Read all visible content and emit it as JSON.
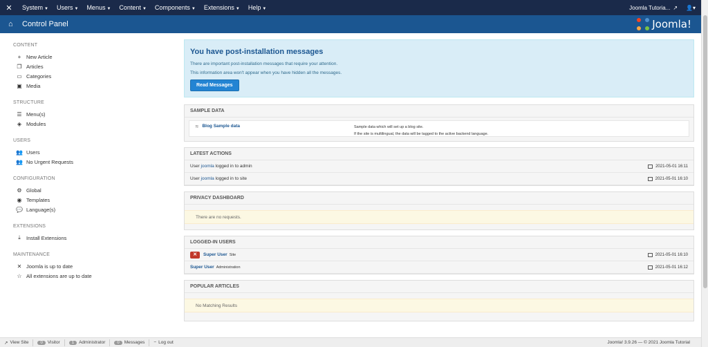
{
  "topnav": {
    "menu": [
      {
        "label": "System"
      },
      {
        "label": "Users"
      },
      {
        "label": "Menus"
      },
      {
        "label": "Content"
      },
      {
        "label": "Components"
      },
      {
        "label": "Extensions"
      },
      {
        "label": "Help"
      }
    ],
    "site_name": "Joomla Tutoria..."
  },
  "header": {
    "title": "Control Panel",
    "brand": "Joomla!"
  },
  "sidebar": {
    "content_heading": "CONTENT",
    "content_items": [
      {
        "label": "New Article",
        "icon": "plus-icon"
      },
      {
        "label": "Articles",
        "icon": "copy-icon"
      },
      {
        "label": "Categories",
        "icon": "folder-icon"
      },
      {
        "label": "Media",
        "icon": "image-icon"
      }
    ],
    "structure_heading": "STRUCTURE",
    "structure_items": [
      {
        "label": "Menu(s)",
        "icon": "list-icon"
      },
      {
        "label": "Modules",
        "icon": "cube-icon"
      }
    ],
    "users_heading": "USERS",
    "users_items": [
      {
        "label": "Users",
        "icon": "users-icon"
      },
      {
        "label": "No Urgent Requests",
        "icon": "users-icon"
      }
    ],
    "configuration_heading": "CONFIGURATION",
    "configuration_items": [
      {
        "label": "Global",
        "icon": "gear-icon"
      },
      {
        "label": "Templates",
        "icon": "eye-icon"
      },
      {
        "label": "Language(s)",
        "icon": "comments-icon"
      }
    ],
    "extensions_heading": "EXTENSIONS",
    "extensions_items": [
      {
        "label": "Install Extensions",
        "icon": "download-icon"
      }
    ],
    "maintenance_heading": "MAINTENANCE",
    "maintenance_items": [
      {
        "label": "Joomla is up to date",
        "icon": "joomla-icon"
      },
      {
        "label": "All extensions are up to date",
        "icon": "star-icon"
      }
    ]
  },
  "alert": {
    "title": "You have post-installation messages",
    "line1": "There are important post-installation messages that require your attention.",
    "line2": "This information area won't appear when you have hidden all the messages.",
    "button": "Read Messages"
  },
  "sample_data": {
    "heading": "SAMPLE DATA",
    "name": "Blog Sample data",
    "desc1": "Sample data which will set up a blog site.",
    "desc2": "If the site is multilingual, the data will be tagged to the active backend language."
  },
  "latest_actions": {
    "heading": "LATEST ACTIONS",
    "rows": [
      {
        "prefix": "User",
        "user": "joomla",
        "suffix": "logged in to admin",
        "date": "2021-05-01 16:11"
      },
      {
        "prefix": "User",
        "user": "joomla",
        "suffix": "logged in to site",
        "date": "2021-05-01 16:10"
      }
    ]
  },
  "privacy": {
    "heading": "PRIVACY DASHBOARD",
    "notice": "There are no requests."
  },
  "logged_in": {
    "heading": "LOGGED-IN USERS",
    "rows": [
      {
        "name": "Super User",
        "role": "Site",
        "date": "2021-05-01 16:10"
      },
      {
        "name": "Super User",
        "role": "Administration",
        "date": "2021-05-01 16:12"
      }
    ]
  },
  "popular": {
    "heading": "POPULAR ARTICLES",
    "notice": "No Matching Results"
  },
  "statusbar": {
    "view_site": "View Site",
    "visitor_count": "0",
    "visitor": "Visitor",
    "admin_count": "1",
    "admin": "Administrator",
    "messages_count": "0",
    "messages": "Messages",
    "logout": "Log out",
    "version": "Joomla! 3.9.26 — © 2021 Joomla Tutorial"
  }
}
